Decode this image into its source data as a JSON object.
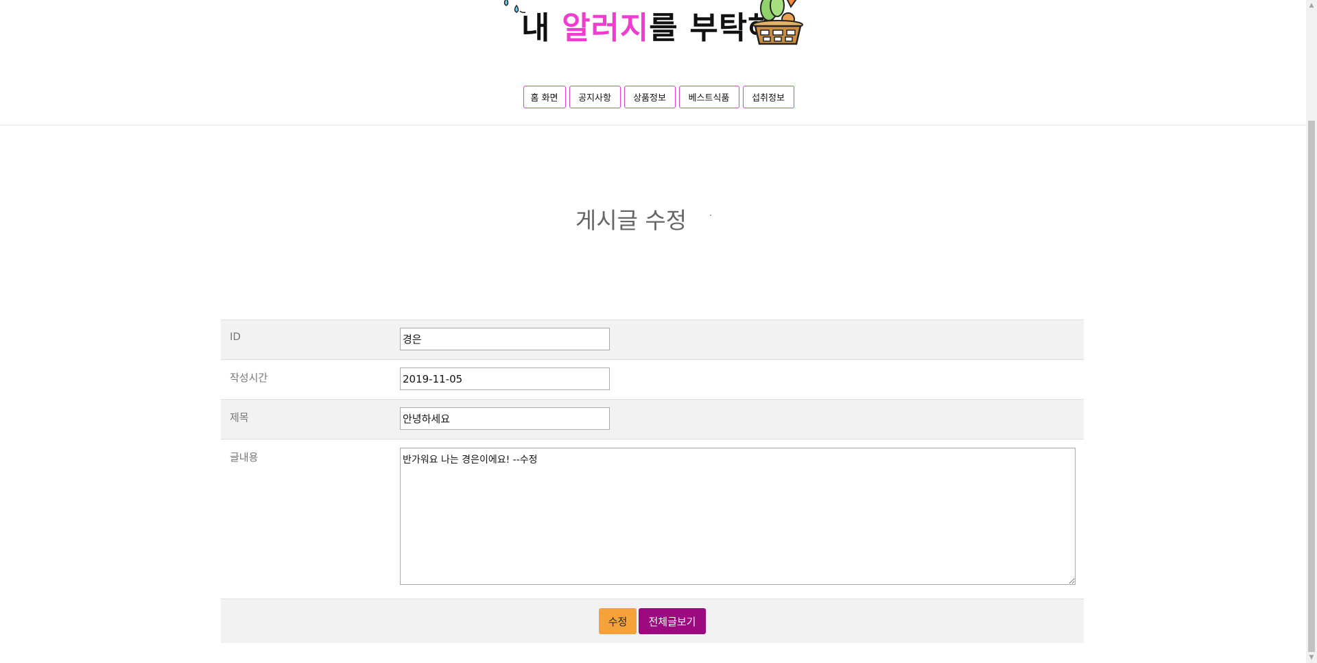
{
  "logo": {
    "part1": "내 ",
    "part2": "알러지",
    "part3": "를 부탁해"
  },
  "nav": {
    "items": [
      {
        "label": "홈 화면"
      },
      {
        "label": "공지사항"
      },
      {
        "label": "상품정보"
      },
      {
        "label": "베스트식품"
      },
      {
        "label": "섭취정보"
      }
    ]
  },
  "page": {
    "title": "게시글 수정"
  },
  "form": {
    "id_label": "ID",
    "id_value": "경은",
    "date_label": "작성시간",
    "date_value": "2019-11-05",
    "subject_label": "제목",
    "subject_value": "안녕하세요",
    "content_label": "글내용",
    "content_value": "반가워요 나는 경은이에요! --수정"
  },
  "actions": {
    "edit_label": "수정",
    "list_label": "전체글보기"
  },
  "colors": {
    "accent_pink": "#f03ccf",
    "edit_button": "#f6a23a",
    "list_button": "#9b0a7e"
  }
}
